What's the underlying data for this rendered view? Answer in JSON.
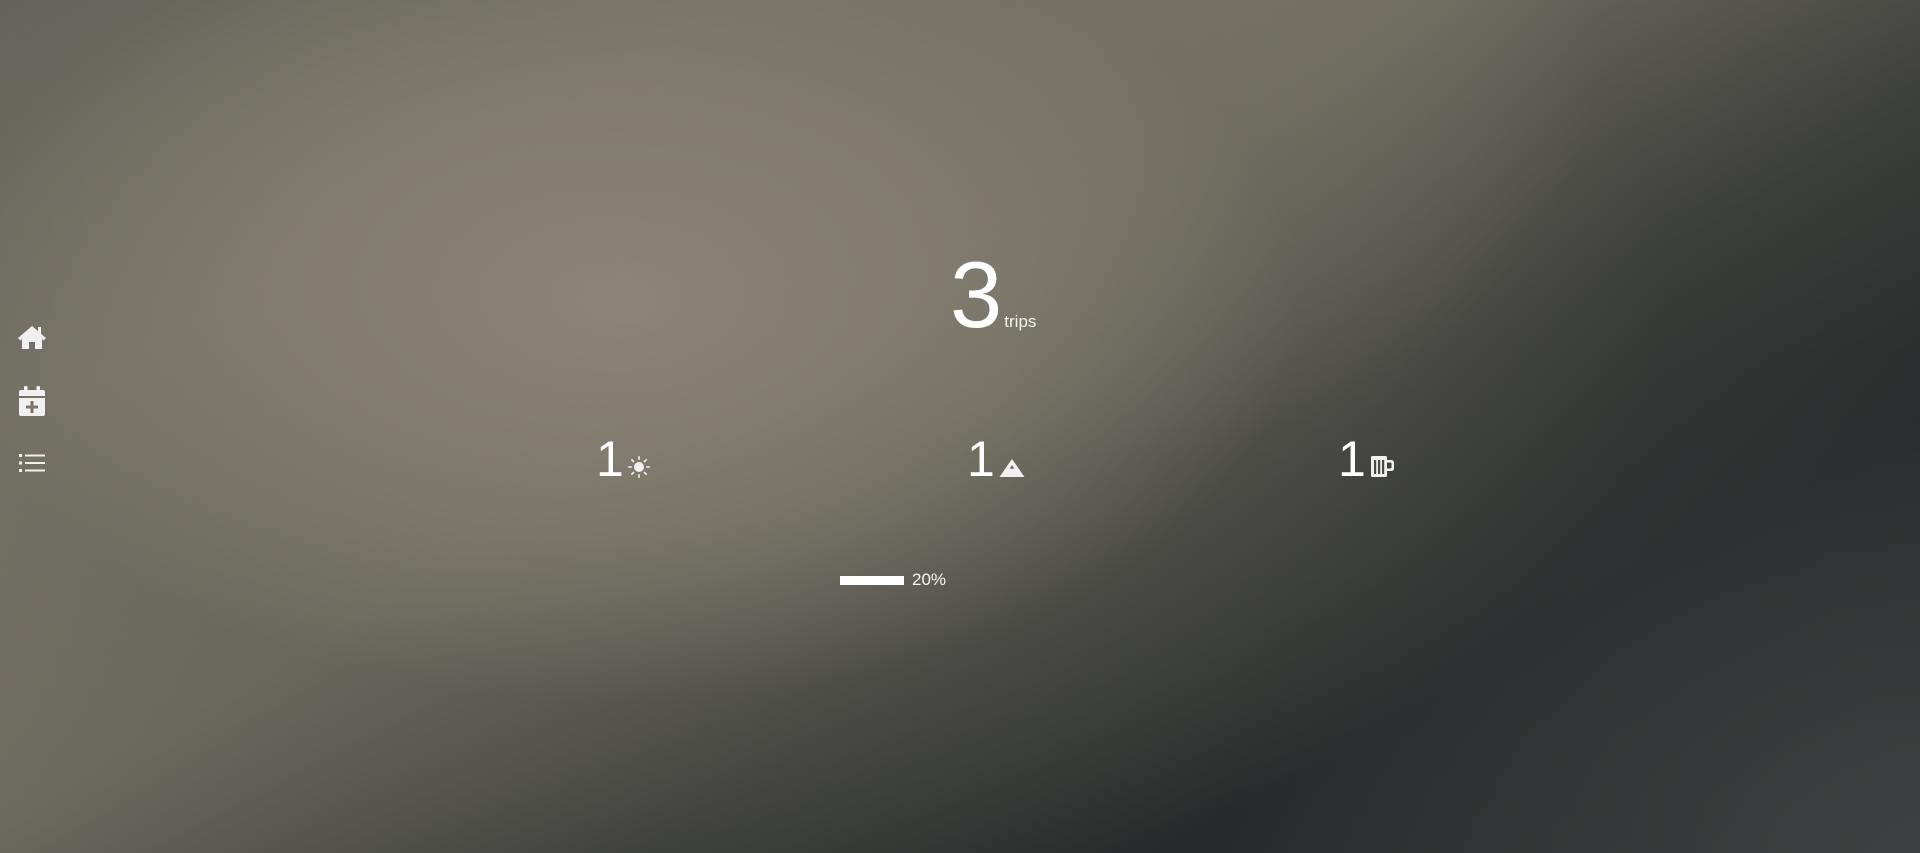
{
  "sidebar": {
    "items": [
      {
        "icon": "home-icon"
      },
      {
        "icon": "calendar-plus-icon"
      },
      {
        "icon": "list-icon"
      }
    ]
  },
  "summary": {
    "total_trips": "3",
    "unit_label": "trips"
  },
  "categories": [
    {
      "count": "1",
      "icon": "sun-icon"
    },
    {
      "count": "1",
      "icon": "mountain-icon"
    },
    {
      "count": "1",
      "icon": "beer-mug-icon"
    }
  ],
  "progress": {
    "value": 1.0,
    "label": "20%"
  },
  "colors": {
    "text": "#ffffff",
    "icon": "#f0f0f0"
  }
}
